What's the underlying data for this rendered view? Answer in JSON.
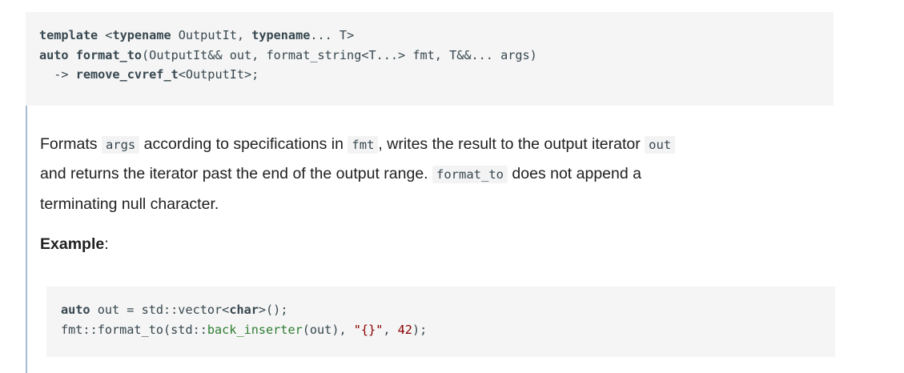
{
  "signature": {
    "line1": {
      "kw1": "template",
      "t1": " <",
      "kw2": "typename",
      "t2": " OutputIt, ",
      "kw3": "typename",
      "t3": "... T>"
    },
    "line2": {
      "kw1": "auto",
      "t1": " ",
      "kw2": "format_to",
      "t2": "(OutputIt&& out, format_string<T...> fmt, T&&... args)"
    },
    "line3": {
      "t1": "  -> ",
      "kw1": "remove_cvref_t",
      "t2": "<OutputIt>;"
    }
  },
  "description": {
    "row1": {
      "a": "Formats ",
      "code1": "args",
      "b": " according to specifications in ",
      "code2": "fmt",
      "c": ", writes the result to the output iterator ",
      "code3": "out"
    },
    "row2": {
      "a": "and returns the iterator past the end of the output range. ",
      "code1": "format_to",
      "b": " does not append a"
    },
    "row3": {
      "a": "terminating null character."
    }
  },
  "example": {
    "label_bold": "Example",
    "label_rest": ":",
    "line1": {
      "kw1": "auto",
      "t1": " out = std::vector<",
      "kw2": "char",
      "t2": ">();"
    },
    "line2": {
      "t1": "fmt::format_to(std::",
      "fn": "back_inserter",
      "t2": "(out), ",
      "str": "\"{}\"",
      "t3": ", ",
      "num": "42",
      "t4": ");"
    }
  }
}
